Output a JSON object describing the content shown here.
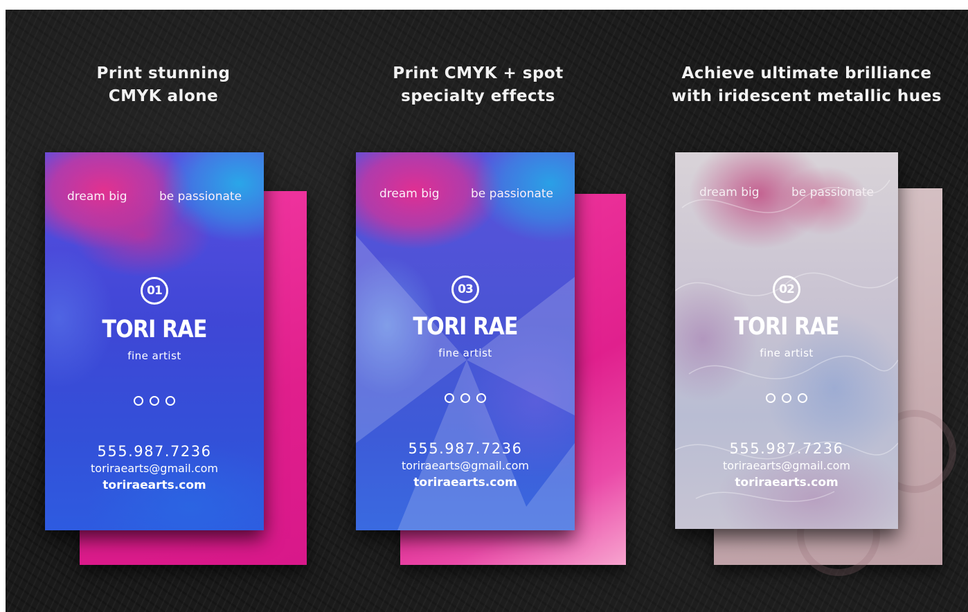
{
  "headings": [
    {
      "line1": "Print stunning",
      "line2": "CMYK alone"
    },
    {
      "line1": "Print CMYK + spot",
      "line2": "specialty effects"
    },
    {
      "line1": "Achieve ultimate brilliance",
      "line2": "with iridescent metallic hues"
    }
  ],
  "cards": [
    {
      "tagline_left": "dream big",
      "tagline_right": "be passionate",
      "number": "01",
      "name": "TORI RAE",
      "role": "fine artist",
      "phone": "555.987.7236",
      "email": "toriraearts@gmail.com",
      "website": "toriraearts.com"
    },
    {
      "tagline_left": "dream big",
      "tagline_right": "be passionate",
      "number": "03",
      "name": "TORI RAE",
      "role": "fine artist",
      "phone": "555.987.7236",
      "email": "toriraearts@gmail.com",
      "website": "toriraearts.com"
    },
    {
      "tagline_left": "dream big",
      "tagline_right": "be passionate",
      "number": "02",
      "name": "TORI RAE",
      "role": "fine artist",
      "phone": "555.987.7236",
      "email": "toriraearts@gmail.com",
      "website": "toriraearts.com"
    }
  ],
  "colors": {
    "background": "#1a1a1a",
    "hot_pink": "#ec2a96",
    "blue": "#3a4fd0",
    "pale_pink": "#cfb6b8"
  }
}
